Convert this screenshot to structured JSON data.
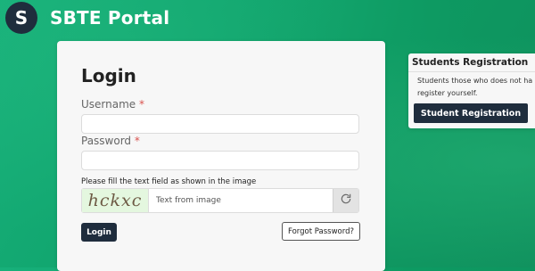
{
  "header": {
    "logo_letter": "S",
    "title": "SBTE Portal"
  },
  "login": {
    "title": "Login",
    "username_label": "Username",
    "password_label": "Password",
    "required_mark": "*",
    "captcha_note": "Please fill the text field as shown in the image",
    "captcha_text": "hckxc",
    "captcha_placeholder": "Text from image",
    "login_button": "Login",
    "forgot_button": "Forgot Password?"
  },
  "registration": {
    "title": "Students Registration",
    "description": "Students those who does not ha register yourself.",
    "button": "Student Registration"
  },
  "colors": {
    "primary": "#1f2d3d",
    "background": "#11a56e",
    "required": "#d9534f"
  },
  "icons": {
    "refresh": "refresh-icon"
  }
}
